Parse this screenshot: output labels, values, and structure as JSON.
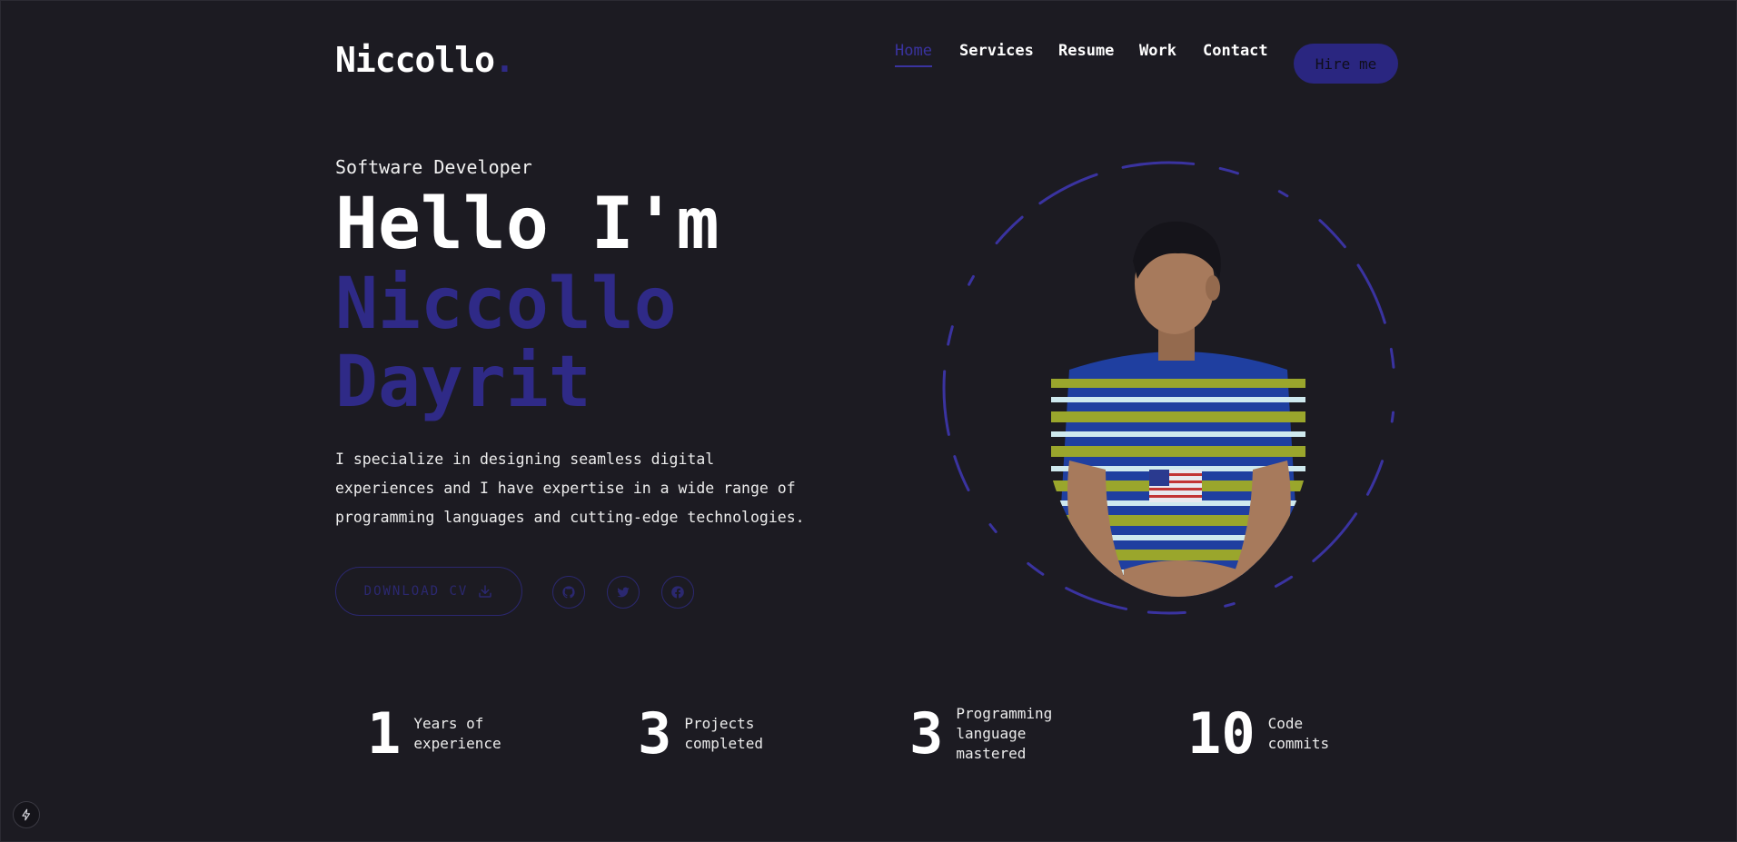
{
  "header": {
    "logo_text": "Niccollo",
    "logo_dot": ".",
    "nav": [
      {
        "label": "Home",
        "active": true
      },
      {
        "label": "Services",
        "active": false
      },
      {
        "label": "Resume",
        "active": false
      },
      {
        "label": "Work",
        "active": false
      },
      {
        "label": "Contact",
        "active": false
      }
    ],
    "hire_label": "Hire me"
  },
  "hero": {
    "role": "Software Developer",
    "greeting": "Hello I'm",
    "name": "Niccollo Dayrit",
    "description": "I specialize in designing seamless digital experiences and I have expertise in a wide range of programming languages and cutting-edge technologies.",
    "download_label": "DOWNLOAD CV",
    "socials": [
      {
        "icon": "github-icon"
      },
      {
        "icon": "twitter-icon"
      },
      {
        "icon": "facebook-icon"
      }
    ]
  },
  "stats": [
    {
      "number": "1",
      "label": "Years of\nexperience"
    },
    {
      "number": "3",
      "label": "Projects\ncompleted"
    },
    {
      "number": "3",
      "label": "Programming\nlanguage\nmastered"
    },
    {
      "number": "10",
      "label": "Code\ncommits"
    }
  ],
  "colors": {
    "background": "#1c1b22",
    "accent": "#2f2a87",
    "text": "#ffffff"
  }
}
